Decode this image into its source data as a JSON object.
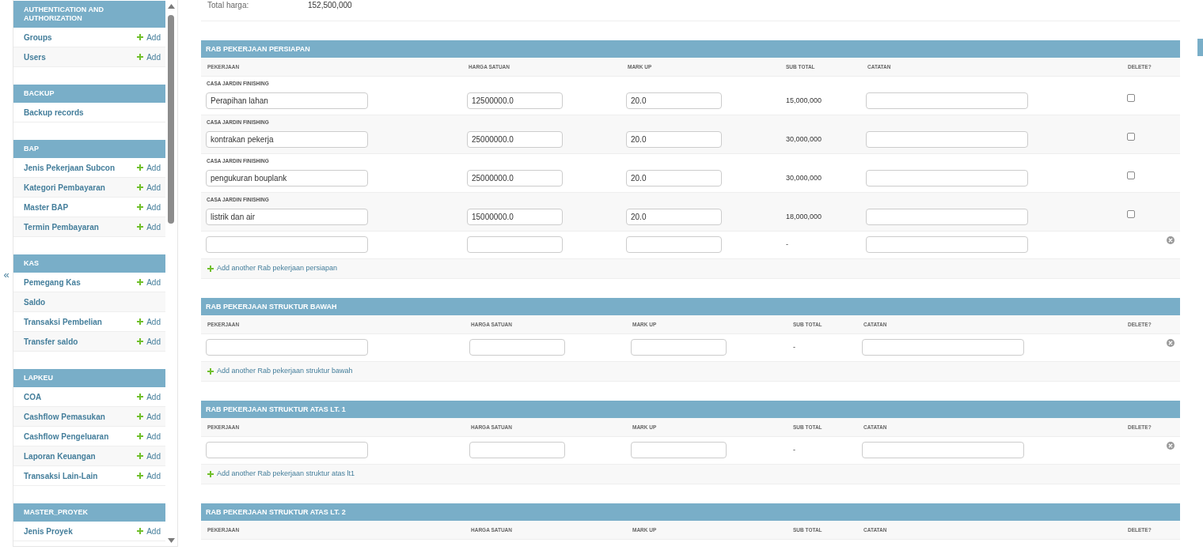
{
  "sidebar": {
    "toggle": "«",
    "modules": [
      {
        "title": "AUTHENTICATION AND AUTHORIZATION",
        "items": [
          {
            "label": "Groups",
            "add": "Add"
          },
          {
            "label": "Users",
            "add": "Add"
          }
        ]
      },
      {
        "title": "BACKUP",
        "items": [
          {
            "label": "Backup records"
          }
        ]
      },
      {
        "title": "BAP",
        "items": [
          {
            "label": "Jenis Pekerjaan Subcon",
            "add": "Add"
          },
          {
            "label": "Kategori Pembayaran",
            "add": "Add"
          },
          {
            "label": "Master BAP",
            "add": "Add"
          },
          {
            "label": "Termin Pembayaran",
            "add": "Add"
          }
        ]
      },
      {
        "title": "KAS",
        "items": [
          {
            "label": "Pemegang Kas",
            "add": "Add"
          },
          {
            "label": "Saldo"
          },
          {
            "label": "Transaksi Pembelian",
            "add": "Add"
          },
          {
            "label": "Transfer saldo",
            "add": "Add"
          }
        ]
      },
      {
        "title": "LAPKEU",
        "items": [
          {
            "label": "COA",
            "add": "Add"
          },
          {
            "label": "Cashflow Pemasukan",
            "add": "Add"
          },
          {
            "label": "Cashflow Pengeluaran",
            "add": "Add"
          },
          {
            "label": "Laporan Keuangan",
            "add": "Add"
          },
          {
            "label": "Transaksi Lain-Lain",
            "add": "Add"
          }
        ]
      },
      {
        "title": "MASTER_PROYEK",
        "items": [
          {
            "label": "Jenis Proyek",
            "add": "Add"
          }
        ]
      }
    ]
  },
  "summary": {
    "label": "Total harga:",
    "value": "152,500,000"
  },
  "inlines": [
    {
      "title": "RAB PEKERJAAN PERSIAPAN",
      "columns": [
        "PEKERJAAN",
        "HARGA SATUAN",
        "MARK UP",
        "SUB TOTAL",
        "CATATAN",
        "DELETE?"
      ],
      "rows": [
        {
          "kind": "existing",
          "group": "CASA JARDIN FINISHING",
          "pekerjaan": "Perapihan lahan",
          "harga_satuan": "12500000.0",
          "mark_up": "20.0",
          "sub_total": "15,000,000",
          "delete": false
        },
        {
          "kind": "existing",
          "group": "CASA JARDIN FINISHING",
          "pekerjaan": "kontrakan pekerja",
          "harga_satuan": "25000000.0",
          "mark_up": "20.0",
          "sub_total": "30,000,000",
          "delete": false
        },
        {
          "kind": "existing",
          "group": "CASA JARDIN FINISHING",
          "pekerjaan": "pengukuran bouplank",
          "harga_satuan": "25000000.0",
          "mark_up": "20.0",
          "sub_total": "30,000,000",
          "delete": false
        },
        {
          "kind": "existing",
          "group": "CASA JARDIN FINISHING",
          "pekerjaan": "listrik dan air",
          "harga_satuan": "15000000.0",
          "mark_up": "20.0",
          "sub_total": "18,000,000",
          "delete": false
        },
        {
          "kind": "blank",
          "sub_total": "-"
        }
      ],
      "add_label": "Add another Rab pekerjaan persiapan"
    },
    {
      "title": "RAB PEKERJAAN STRUKTUR BAWAH",
      "columns": [
        "PEKERJAAN",
        "HARGA SATUAN",
        "MARK UP",
        "SUB TOTAL",
        "CATATAN",
        "DELETE?"
      ],
      "rows": [
        {
          "kind": "blank",
          "sub_total": "-"
        }
      ],
      "add_label": "Add another Rab pekerjaan struktur bawah"
    },
    {
      "title": "RAB PEKERJAAN STRUKTUR ATAS LT. 1",
      "columns": [
        "PEKERJAAN",
        "HARGA SATUAN",
        "MARK UP",
        "SUB TOTAL",
        "CATATAN",
        "DELETE?"
      ],
      "rows": [
        {
          "kind": "blank",
          "sub_total": "-"
        }
      ],
      "add_label": "Add another Rab pekerjaan struktur atas lt1"
    },
    {
      "title": "RAB PEKERJAAN STRUKTUR ATAS LT. 2",
      "columns": [
        "PEKERJAAN",
        "HARGA SATUAN",
        "MARK UP",
        "SUB TOTAL",
        "CATATAN",
        "DELETE?"
      ]
    }
  ]
}
